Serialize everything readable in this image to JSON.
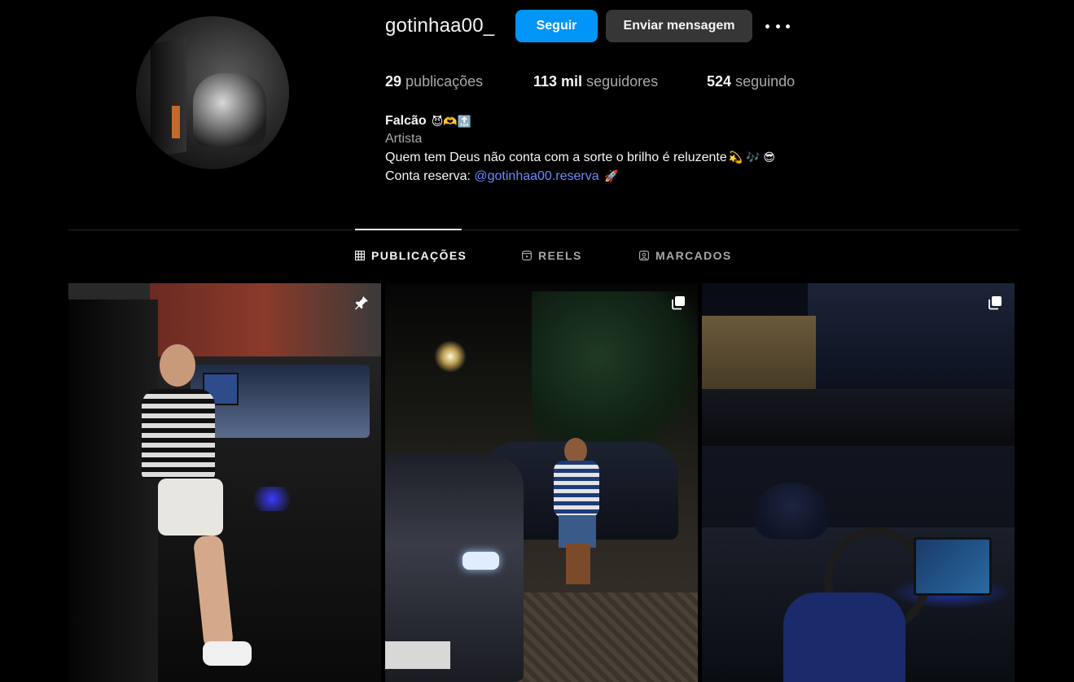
{
  "profile": {
    "username": "gotinhaa00_",
    "follow_label": "Seguir",
    "message_label": "Enviar mensagem",
    "stats": {
      "posts_count": "29",
      "posts_label": "publicações",
      "followers_count": "113 mil",
      "followers_label": "seguidores",
      "following_count": "524",
      "following_label": "seguindo"
    },
    "bio": {
      "name": "Falcão",
      "name_emojis": "😈🫶🔝",
      "category": "Artista",
      "line1": "Quem tem Deus não conta com a sorte o brilho é reluzente",
      "line1_emojis": "💫 🎶 😎",
      "line2_prefix": "Conta reserva:",
      "line2_link": "@gotinhaa00.reserva",
      "line2_emoji": "🚀"
    }
  },
  "tabs": [
    {
      "label": "PUBLICAÇÕES",
      "icon": "grid-icon",
      "active": true
    },
    {
      "label": "REELS",
      "icon": "reels-icon",
      "active": false
    },
    {
      "label": "MARCADOS",
      "icon": "tagged-icon",
      "active": false
    }
  ],
  "posts": [
    {
      "badge": "pin-icon"
    },
    {
      "badge": "carousel-icon"
    },
    {
      "badge": "carousel-icon"
    }
  ],
  "colors": {
    "accent": "#0095f6",
    "link": "#6a8cff",
    "secondary_button": "#363636",
    "background": "#000000"
  }
}
